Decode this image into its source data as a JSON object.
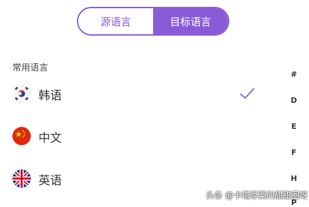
{
  "segmented": {
    "source_label": "源语言",
    "target_label": "目标语言"
  },
  "section": {
    "common_title": "常用语言"
  },
  "languages": [
    {
      "label": "韩语",
      "flag": "korea-flag-icon",
      "selected": true
    },
    {
      "label": "中文",
      "flag": "china-flag-icon",
      "selected": false
    },
    {
      "label": "英语",
      "flag": "uk-flag-icon",
      "selected": false
    }
  ],
  "index_letters": [
    "#",
    "D",
    "E",
    "F",
    "H",
    "P"
  ],
  "watermark": "头条 @卡塔厚粟的甜甜圈呀",
  "colors": {
    "accent": "#8a5bd6",
    "check": "#7b6bd8"
  }
}
